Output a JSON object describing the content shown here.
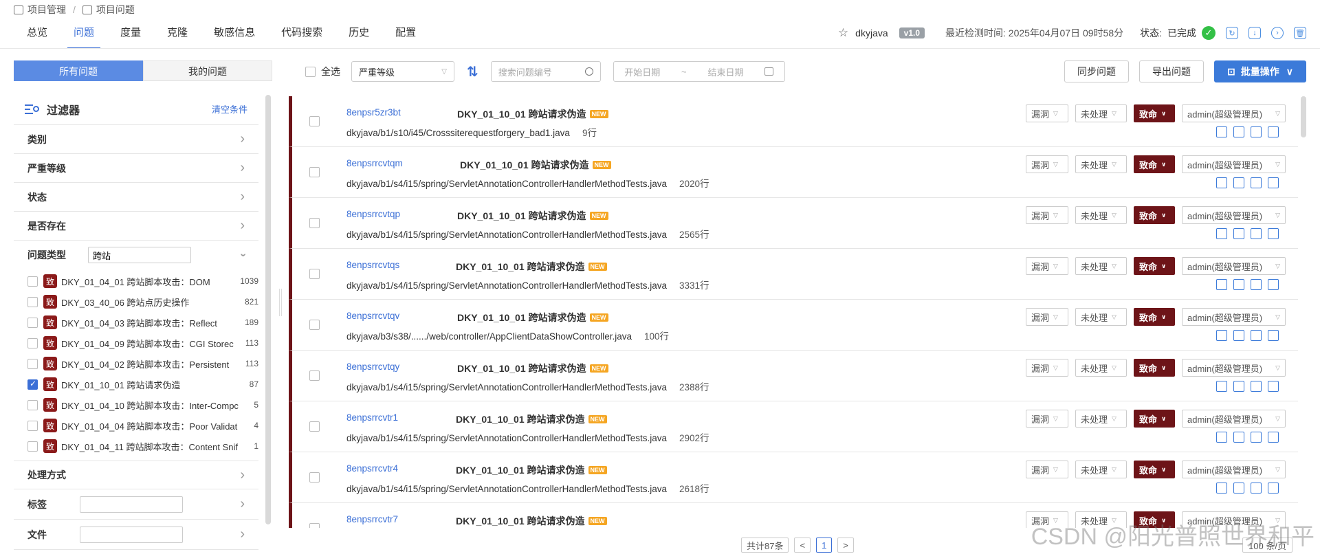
{
  "breadcrumb": {
    "root": "项目管理",
    "sep": "/",
    "current": "项目问题"
  },
  "nav": {
    "tabs": [
      "总览",
      "问题",
      "度量",
      "克隆",
      "敏感信息",
      "代码搜索",
      "历史",
      "配置"
    ],
    "active": 1
  },
  "project": {
    "name": "dkyjava",
    "version": "v1.0",
    "last_check": "最近检测时间: 2025年04月07日 09时58分",
    "status_label": "状态:",
    "status_value": "已完成"
  },
  "segment": {
    "all": "所有问题",
    "mine": "我的问题"
  },
  "filter": {
    "title": "过滤器",
    "clear": "清空条件",
    "sections_top": [
      "类别",
      "严重等级",
      "状态",
      "是否存在"
    ],
    "type_label": "问题类型",
    "type_search": "跨站",
    "types": [
      {
        "badge": "致",
        "name": "DKY_01_04_01 跨站脚本攻击：DOM",
        "count": "1039",
        "checked": false
      },
      {
        "badge": "致",
        "name": "DKY_03_40_06 跨站点历史操作",
        "count": "821",
        "checked": false
      },
      {
        "badge": "致",
        "name": "DKY_01_04_03 跨站脚本攻击：Reflect",
        "count": "189",
        "checked": false
      },
      {
        "badge": "致",
        "name": "DKY_01_04_09 跨站脚本攻击：CGI Storec",
        "count": "113",
        "checked": false
      },
      {
        "badge": "致",
        "name": "DKY_01_04_02 跨站脚本攻击：Persistent",
        "count": "113",
        "checked": false
      },
      {
        "badge": "致",
        "name": "DKY_01_10_01 跨站请求伪造",
        "count": "87",
        "checked": true
      },
      {
        "badge": "致",
        "name": "DKY_01_04_10 跨站脚本攻击：Inter-Compc",
        "count": "5",
        "checked": false
      },
      {
        "badge": "致",
        "name": "DKY_01_04_04 跨站脚本攻击：Poor Validat",
        "count": "4",
        "checked": false
      },
      {
        "badge": "致",
        "name": "DKY_01_04_11 跨站脚本攻击：Content Snif",
        "count": "1",
        "checked": false
      }
    ],
    "handling": "处理方式",
    "tags": "标签",
    "files": "文件"
  },
  "toolbar": {
    "select_all": "全选",
    "severity_placeholder": "严重等级",
    "search_placeholder": "搜索问题编号",
    "start_date": "开始日期",
    "date_sep": "~",
    "end_date": "结束日期",
    "sync": "同步问题",
    "export": "导出问题",
    "batch": "批量操作"
  },
  "issues": [
    {
      "id": "8enpsr5zr3bt",
      "rule": "DKY_01_10_01 跨站请求伪造",
      "path": "dkyjava/b1/s10/i45/Crosssiterequestforgery_bad1.java",
      "lines": "9行",
      "kind": "漏洞",
      "state": "未处理",
      "severity": "致命",
      "user": "admin(超级管理员)"
    },
    {
      "id": "8enpsrrcvtqm",
      "rule": "DKY_01_10_01 跨站请求伪造",
      "path": "dkyjava/b1/s4/i15/spring/ServletAnnotationControllerHandlerMethodTests.java",
      "lines": "2020行",
      "kind": "漏洞",
      "state": "未处理",
      "severity": "致命",
      "user": "admin(超级管理员)"
    },
    {
      "id": "8enpsrrcvtqp",
      "rule": "DKY_01_10_01 跨站请求伪造",
      "path": "dkyjava/b1/s4/i15/spring/ServletAnnotationControllerHandlerMethodTests.java",
      "lines": "2565行",
      "kind": "漏洞",
      "state": "未处理",
      "severity": "致命",
      "user": "admin(超级管理员)"
    },
    {
      "id": "8enpsrrcvtqs",
      "rule": "DKY_01_10_01 跨站请求伪造",
      "path": "dkyjava/b1/s4/i15/spring/ServletAnnotationControllerHandlerMethodTests.java",
      "lines": "3331行",
      "kind": "漏洞",
      "state": "未处理",
      "severity": "致命",
      "user": "admin(超级管理员)"
    },
    {
      "id": "8enpsrrcvtqv",
      "rule": "DKY_01_10_01 跨站请求伪造",
      "path": "dkyjava/b3/s38/....../web/controller/AppClientDataShowController.java",
      "lines": "100行",
      "kind": "漏洞",
      "state": "未处理",
      "severity": "致命",
      "user": "admin(超级管理员)"
    },
    {
      "id": "8enpsrrcvtqy",
      "rule": "DKY_01_10_01 跨站请求伪造",
      "path": "dkyjava/b1/s4/i15/spring/ServletAnnotationControllerHandlerMethodTests.java",
      "lines": "2388行",
      "kind": "漏洞",
      "state": "未处理",
      "severity": "致命",
      "user": "admin(超级管理员)"
    },
    {
      "id": "8enpsrrcvtr1",
      "rule": "DKY_01_10_01 跨站请求伪造",
      "path": "dkyjava/b1/s4/i15/spring/ServletAnnotationControllerHandlerMethodTests.java",
      "lines": "2902行",
      "kind": "漏洞",
      "state": "未处理",
      "severity": "致命",
      "user": "admin(超级管理员)"
    },
    {
      "id": "8enpsrrcvtr4",
      "rule": "DKY_01_10_01 跨站请求伪造",
      "path": "dkyjava/b1/s4/i15/spring/ServletAnnotationControllerHandlerMethodTests.java",
      "lines": "2618行",
      "kind": "漏洞",
      "state": "未处理",
      "severity": "致命",
      "user": "admin(超级管理员)"
    },
    {
      "id": "8enpsrrcvtr7",
      "rule": "DKY_01_10_01 跨站请求伪造",
      "path": "",
      "lines": "",
      "kind": "漏洞",
      "state": "未处理",
      "severity": "致命",
      "user": "admin(超级管理员)"
    }
  ],
  "new_badge": "NEW",
  "pager": {
    "total": "共计87条",
    "prev": "<",
    "page": "1",
    "next": ">",
    "size": "100 条/页"
  },
  "watermark": "CSDN @阳光普照世界和平",
  "colors": {
    "accent": "#3b6fd6",
    "severity": "#6d1418",
    "ok": "#33c046"
  }
}
